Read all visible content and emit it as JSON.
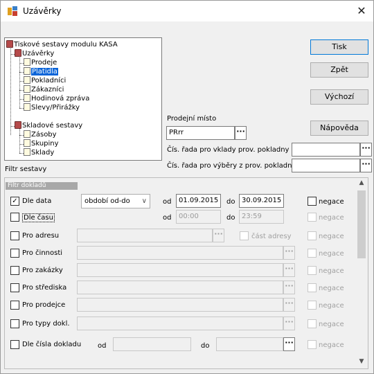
{
  "window": {
    "title": "Uzávěrky",
    "close_symbol": "✕"
  },
  "tree": {
    "root": "Tiskové sestavy modulu KASA",
    "uzaverky": "Uzávěrky",
    "uzaverky_items": [
      "Prodeje",
      "Platidla",
      "Pokladníci",
      "Zákazníci",
      "Hodinová zpráva",
      "Slevy/Přirážky"
    ],
    "selected": "Platidla",
    "skladove": "Skladové sestavy",
    "skladove_items": [
      "Zásoby",
      "Skupiny",
      "Sklady"
    ]
  },
  "buttons": {
    "tisk": "Tisk",
    "zpet": "Zpět",
    "vychozi": "Výchozí",
    "napoveda": "Nápověda"
  },
  "prodejni_misto": {
    "label": "Prodejní místo",
    "value": "PRrr",
    "dots": "···"
  },
  "cis_rada_vklady": {
    "label": "Čís. řada pro vklady",
    "label2": "prov. pokladny",
    "value": "",
    "dots": "···"
  },
  "cis_rada_vybery": {
    "label": "Čís. řada pro výběry z prov. pokladny",
    "value": "",
    "dots": "···"
  },
  "filtr_sestavy": "Filtr sestavy",
  "filtr_dokladu": "Filtr dokladů",
  "rows": {
    "dle_data": {
      "label": "Dle data",
      "checked": "✓",
      "combo": "období od-do",
      "od": "od",
      "od_val": "01.09.2015",
      "do": "do",
      "do_val": "30.09.2015",
      "negace": "negace"
    },
    "dle_casu": {
      "label": "Dle času",
      "od": "od",
      "od_val": "00:00",
      "do": "do",
      "do_val": "23:59",
      "negace": "negace"
    },
    "pro_adresu": {
      "label": "Pro adresu",
      "cast": "část adresy",
      "negace": "negace"
    },
    "pro_cinnosti": {
      "label": "Pro činnosti",
      "negace": "negace"
    },
    "pro_zakazky": {
      "label": "Pro zakázky",
      "negace": "negace"
    },
    "pro_strediska": {
      "label": "Pro střediska",
      "negace": "negace"
    },
    "pro_prodejce": {
      "label": "Pro prodejce",
      "negace": "negace"
    },
    "pro_typy": {
      "label": "Pro typy dokl.",
      "negace": "negace"
    },
    "dle_cisla": {
      "label": "Dle čísla dokladu",
      "od": "od",
      "do": "do",
      "negace": "negace"
    }
  },
  "dots": "···",
  "combo_arrow": "∨"
}
